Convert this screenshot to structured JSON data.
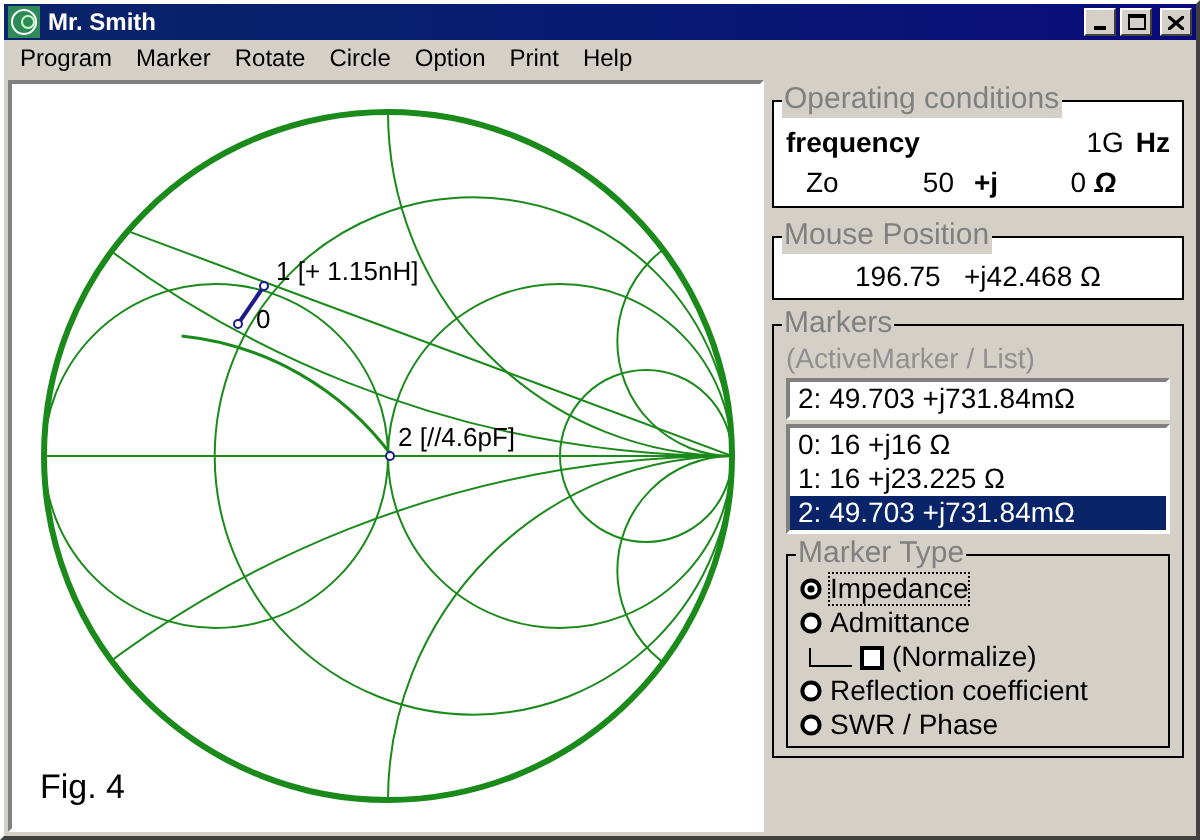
{
  "window": {
    "title": "Mr. Smith"
  },
  "menu": [
    "Program",
    "Marker",
    "Rotate",
    "Circle",
    "Option",
    "Print",
    "Help"
  ],
  "chart": {
    "caption": "Fig. 4",
    "marker_labels": [
      {
        "text": "1 [+ 1.15nH]"
      },
      {
        "text": "0"
      },
      {
        "text": "2 [//4.6pF]"
      }
    ]
  },
  "operating_conditions": {
    "title": "Operating conditions",
    "frequency_label": "frequency",
    "frequency_value": "1G",
    "frequency_unit": "Hz",
    "zo_label": "Zo",
    "zo_real": "50",
    "j_label": "+j",
    "zo_imag": "0",
    "unit": "Ω"
  },
  "mouse_position": {
    "title": "Mouse Position",
    "value": "196.75   +j42.468 Ω"
  },
  "markers": {
    "title": "Markers",
    "hint": "(ActiveMarker / List)",
    "active": "2: 49.703 +j731.84mΩ",
    "list": [
      {
        "text": "0: 16 +j16 Ω",
        "selected": false
      },
      {
        "text": "1: 16 +j23.225 Ω",
        "selected": false
      },
      {
        "text": "2: 49.703 +j731.84mΩ",
        "selected": true
      }
    ]
  },
  "marker_type": {
    "title": "Marker Type",
    "options": [
      {
        "kind": "radio",
        "label": "Impedance",
        "selected": true
      },
      {
        "kind": "radio",
        "label": "Admittance",
        "selected": false
      },
      {
        "kind": "checkbox",
        "label": "(Normalize)",
        "checked": false
      },
      {
        "kind": "radio",
        "label": "Reflection coefficient",
        "selected": false
      },
      {
        "kind": "radio",
        "label": "SWR / Phase",
        "selected": false
      }
    ]
  }
}
